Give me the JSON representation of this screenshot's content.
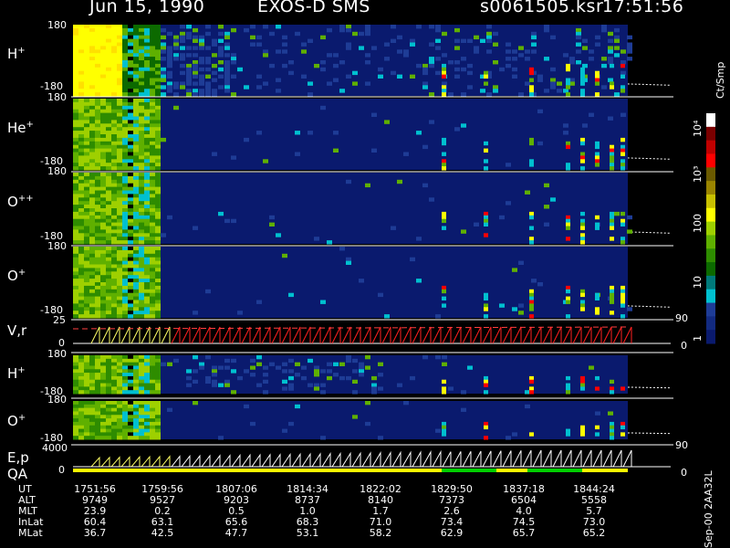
{
  "header": {
    "date": "Jun 15, 1990",
    "instrument": "EXOS-D SMS",
    "file": "s0061505.ksr",
    "time": "17:51:56"
  },
  "panel_labels": {
    "h_plus_1": {
      "base": "H",
      "sup": "+"
    },
    "he_plus": {
      "base": "He",
      "sup": "+"
    },
    "o_plus_plus": {
      "base": "O",
      "sup": "++"
    },
    "o_plus_1": {
      "base": "O",
      "sup": "+"
    },
    "vr": "V,r",
    "h_plus_2": {
      "base": "H",
      "sup": "+"
    },
    "o_plus_2": {
      "base": "O",
      "sup": "+"
    },
    "ep": "E,p",
    "qa": "QA"
  },
  "ticks": {
    "pitch_top": "180",
    "pitch_bottom": "-180",
    "vr_top": "25",
    "vr_zero": "0",
    "ep_top": "4000",
    "ep_zero": "0",
    "right_90": "90",
    "right_0": "0"
  },
  "colorbar": {
    "unit": "Ct/Smp",
    "labels": [
      "10⁴",
      "10³",
      "100",
      "10",
      "1"
    ],
    "colors": [
      "#ffffff",
      "#7a0000",
      "#c00000",
      "#ff0000",
      "#6b5a00",
      "#9a8400",
      "#c8c000",
      "#ffff00",
      "#9ed000",
      "#5fb000",
      "#2e8c00",
      "#0c6a00",
      "#007a7a",
      "#00c0d0",
      "#1e3c96",
      "#122a80",
      "#0a1a6e"
    ]
  },
  "footer": {
    "version": "Sep-00 2AA32L",
    "rows": [
      {
        "label": "UT",
        "values": [
          "1751:56",
          "1759:56",
          "1807:06",
          "1814:34",
          "1822:02",
          "1829:50",
          "1837:18",
          "1844:24"
        ]
      },
      {
        "label": "ALT",
        "values": [
          "9749",
          "9527",
          "9203",
          "8737",
          "8140",
          "7373",
          "6504",
          "5558"
        ]
      },
      {
        "label": "MLT",
        "values": [
          "23.9",
          "0.2",
          "0.5",
          "1.0",
          "1.7",
          "2.6",
          "4.0",
          "5.7"
        ]
      },
      {
        "label": "InLat",
        "values": [
          "60.4",
          "63.1",
          "65.6",
          "68.3",
          "71.0",
          "73.4",
          "74.5",
          "73.0"
        ]
      },
      {
        "label": "MLat",
        "values": [
          "36.7",
          "42.5",
          "47.7",
          "53.1",
          "58.2",
          "62.9",
          "65.7",
          "65.2"
        ]
      }
    ]
  },
  "chart_data": {
    "type": "heatmap",
    "x_time_axis": [
      "1751:56",
      "1759:56",
      "1807:06",
      "1814:34",
      "1822:02",
      "1829:50",
      "1837:18",
      "1844:24"
    ],
    "series": [
      {
        "name": "H+",
        "ylim": [
          -180,
          180
        ]
      },
      {
        "name": "He+",
        "ylim": [
          -180,
          180
        ]
      },
      {
        "name": "O++",
        "ylim": [
          -180,
          180
        ]
      },
      {
        "name": "O+",
        "ylim": [
          -180,
          180
        ]
      },
      {
        "name": "V,r",
        "ylim": [
          0,
          25
        ],
        "right_ylim": [
          0,
          90
        ]
      },
      {
        "name": "H+",
        "ylim": [
          -180,
          180
        ]
      },
      {
        "name": "O+",
        "ylim": [
          -180,
          180
        ],
        "right_ylim": [
          0,
          90
        ]
      },
      {
        "name": "E,p",
        "ylim": [
          0,
          4000
        ]
      },
      {
        "name": "QA"
      }
    ],
    "colorbar_unit": "Ct/Smp",
    "colorbar_ticks": [
      "1",
      "10",
      "100",
      "10³",
      "10⁴"
    ]
  }
}
